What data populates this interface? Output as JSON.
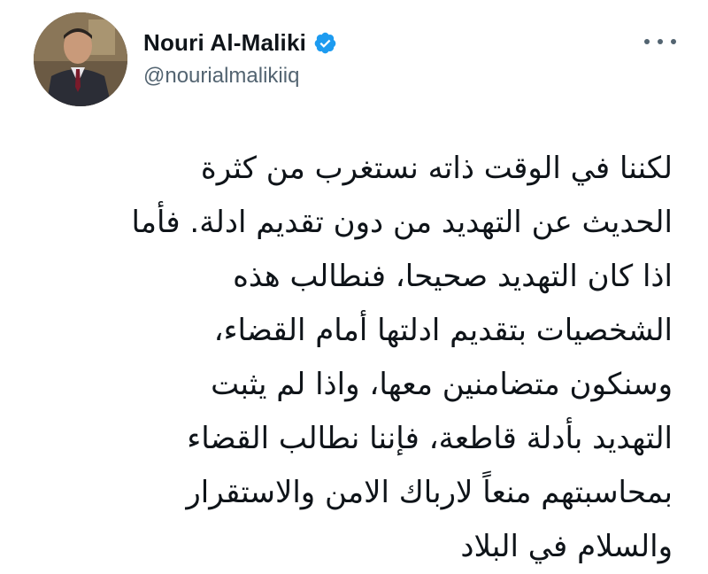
{
  "user": {
    "display_name": "Nouri Al-Maliki",
    "handle": "@nourialmalikiiq",
    "verified": true,
    "avatar_icon": "profile-photo"
  },
  "colors": {
    "verified_badge": "#1d9bf0",
    "text_primary": "#0f1419",
    "text_secondary": "#536471"
  },
  "more_icon": "more-options-icon",
  "tweet": {
    "lines": [
      "لكننا في الوقت ذاته نستغرب من كثرة",
      "الحديث عن التهديد من دون تقديم ادلة. فأما",
      "اذا كان التهديد صحيحا، فنطالب هذه",
      "الشخصيات بتقديم ادلتها أمام القضاء،",
      "وسنكون متضامنين معها، واذا لم يثبت",
      "التهديد بأدلة قاطعة، فإننا نطالب القضاء",
      "بمحاسبتهم منعاً لارباك الامن والاستقرار",
      "والسلام في البلاد"
    ]
  }
}
